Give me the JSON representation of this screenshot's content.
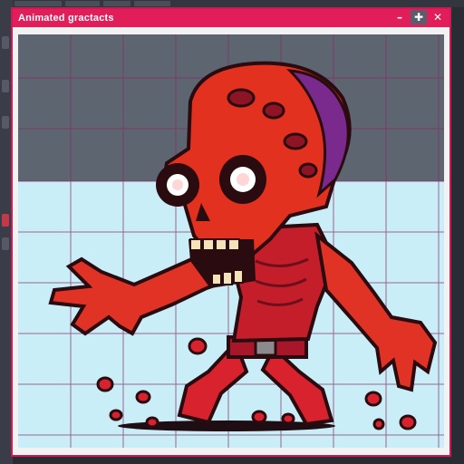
{
  "window": {
    "title": "Animated gractacts",
    "controls": [
      "–",
      "✚",
      "✕"
    ]
  },
  "canvas": {
    "colors": {
      "upper_background": "#5c6570",
      "lower_background": "#c9eef7",
      "grid_line": "#8a2b6a",
      "accent": "#e11e5a"
    },
    "sprite": "red-zombie-pixel-art"
  }
}
